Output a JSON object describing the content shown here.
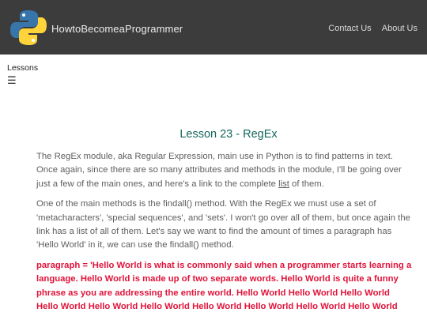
{
  "header": {
    "brand": "HowtoBecomeaProgrammer",
    "nav": [
      "Contact Us",
      "About Us"
    ]
  },
  "sidebar": {
    "label": "Lessons",
    "menu_icon": "☰"
  },
  "lesson": {
    "title": "Lesson 23 - RegEx",
    "p1_before": "The RegEx module, aka Regular Expression, main use in Python is to find patterns in text. Once again, since there are so many attributes and methods in the module, I'll be going over just a few of the main ones, and here's a link to the complete ",
    "p1_link": "list",
    "p1_after": " of them.",
    "p2": "One of the main methods is the findall() method. With the RegEx we must use a set of 'metacharacters', 'special sequences', and 'sets'. I won't go over all of them, but once again the link has a list of all of them. Let's say we want to find the amount of times a paragraph has 'Hello World' in it, we can use the findall() method.",
    "code": "paragraph = 'Hello World is what is commonly said when a programmer starts learning a language. Hello World is made up of two separate words. Hello World is quite a funny phrase as you are addressing the entire world. Hello World Hello World Hello World Hello World Hello World Hello World Hello World Hello World Hello World Hello World"
  },
  "colors": {
    "navbar": "#3c3c3c",
    "title": "#14665c",
    "code": "#e0133a",
    "body_text": "#5e5e5e"
  }
}
